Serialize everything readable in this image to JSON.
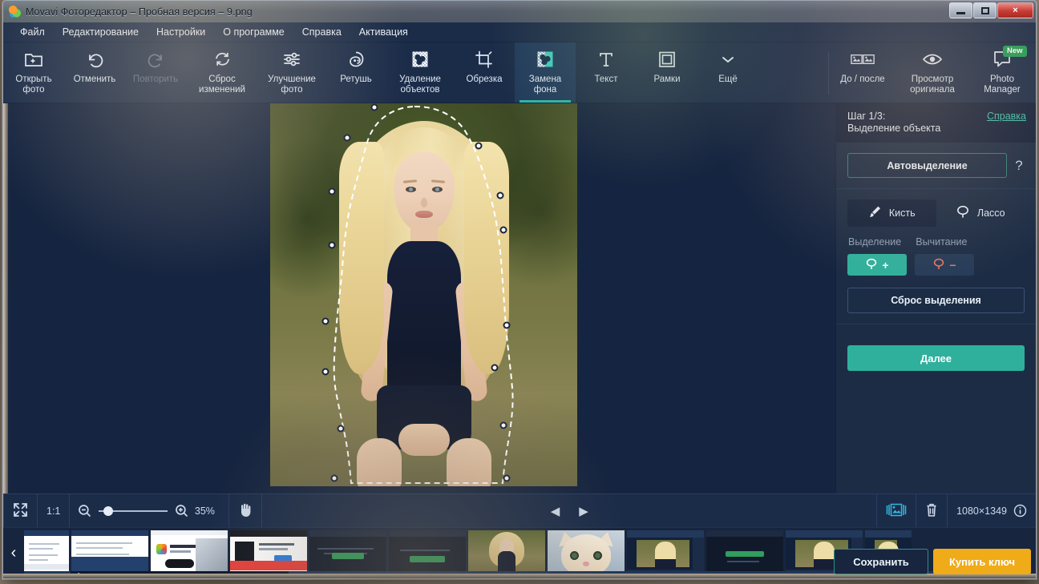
{
  "window": {
    "title": "Movavi Фоторедактор – Пробная версия – 9.png",
    "minimize_label": "Свернуть",
    "maximize_label": "Развернуть",
    "close_label": "×"
  },
  "menubar": {
    "items": [
      {
        "label": "Файл"
      },
      {
        "label": "Редактирование"
      },
      {
        "label": "Настройки"
      },
      {
        "label": "О программе"
      },
      {
        "label": "Справка"
      },
      {
        "label": "Активация"
      }
    ]
  },
  "toolbar": {
    "items": [
      {
        "id": "open-photo",
        "label": "Открыть\nфото",
        "icon": "folder-plus-icon",
        "state": "enabled"
      },
      {
        "id": "undo",
        "label": "Отменить",
        "icon": "undo-icon",
        "state": "enabled"
      },
      {
        "id": "redo",
        "label": "Повторить",
        "icon": "redo-icon",
        "state": "disabled"
      },
      {
        "id": "reset-changes",
        "label": "Сброс\nизменений",
        "icon": "refresh-icon",
        "state": "enabled"
      },
      {
        "id": "enhance-photo",
        "label": "Улучшение\nфото",
        "icon": "sliders-icon",
        "state": "enabled"
      },
      {
        "id": "retouch",
        "label": "Ретушь",
        "icon": "face-icon",
        "state": "enabled"
      },
      {
        "id": "object-removal",
        "label": "Удаление\nобъектов",
        "icon": "eraser-icon",
        "state": "enabled"
      },
      {
        "id": "crop",
        "label": "Обрезка",
        "icon": "crop-icon",
        "state": "enabled"
      },
      {
        "id": "background-change",
        "label": "Замена\nфона",
        "icon": "bg-change-icon",
        "state": "active"
      },
      {
        "id": "text",
        "label": "Текст",
        "icon": "text-t-icon",
        "state": "enabled"
      },
      {
        "id": "frames",
        "label": "Рамки",
        "icon": "frame-icon",
        "state": "enabled"
      },
      {
        "id": "more",
        "label": "Ещё",
        "icon": "chevron-down-icon",
        "state": "enabled"
      }
    ],
    "right_items": [
      {
        "id": "before-after",
        "label": "До / после",
        "icon": "before-after-icon"
      },
      {
        "id": "view-original",
        "label": "Просмотр\nоригинала",
        "icon": "eye-icon"
      },
      {
        "id": "photo-manager",
        "label": "Photo\nManager",
        "icon": "speech-bubble-icon",
        "badge": "New"
      }
    ]
  },
  "right_panel": {
    "step_title": "Шаг 1/3:\nВыделение объекта",
    "help_link": "Справка",
    "auto_select_button": "Автовыделение",
    "auto_select_hint": "?",
    "tools": [
      {
        "id": "brush",
        "label": "Кисть",
        "icon": "brush-icon",
        "selected": true
      },
      {
        "id": "lasso",
        "label": "Лассо",
        "icon": "lasso-icon",
        "selected": false
      }
    ],
    "mode_labels": {
      "select": "Выделение",
      "subtract": "Вычитание"
    },
    "mode_add_icon": "lasso-plus-icon",
    "mode_sub_icon": "lasso-minus-icon",
    "mode_add_glyph": "+",
    "mode_sub_glyph": "−",
    "reset_selection_button": "Сброс выделения",
    "next_button": "Далее"
  },
  "statusbar": {
    "fit_icon": "fit-screen-icon",
    "one_to_one": "1:1",
    "zoom_out_icon": "zoom-out-icon",
    "zoom_in_icon": "zoom-in-icon",
    "zoom_value": "35%",
    "zoom_slider_percent": 8,
    "hand_icon": "hand-icon",
    "prev_icon": "◀",
    "next_icon": "▶",
    "compare_icon": "compare-images-icon",
    "delete_icon": "trash-icon",
    "image_size": "1080×1349",
    "info_icon": "info-icon"
  },
  "filmstrip": {
    "prev_arrow": "‹",
    "next_arrow": "›",
    "thumbnails": [
      {
        "id": "thumb-0",
        "kind": "doc",
        "selected": false,
        "partial": "left"
      },
      {
        "id": "thumb-1",
        "kind": "doc",
        "selected": false
      },
      {
        "id": "thumb-2",
        "kind": "doc2",
        "selected": false
      },
      {
        "id": "thumb-3",
        "kind": "web",
        "selected": false
      },
      {
        "id": "thumb-4",
        "kind": "red",
        "selected": false
      },
      {
        "id": "thumb-5",
        "kind": "dark",
        "selected": false
      },
      {
        "id": "thumb-6",
        "kind": "dark2",
        "selected": false
      },
      {
        "id": "thumb-7",
        "kind": "photo",
        "selected": true
      },
      {
        "id": "thumb-8",
        "kind": "cat",
        "selected": false
      },
      {
        "id": "thumb-9",
        "kind": "app",
        "selected": false
      },
      {
        "id": "thumb-10",
        "kind": "dark3",
        "selected": false
      },
      {
        "id": "thumb-11",
        "kind": "app2",
        "selected": false,
        "partial": "right"
      }
    ]
  },
  "actions": {
    "save_button": "Сохранить",
    "buy_key_button": "Купить ключ"
  },
  "colors": {
    "accent_teal": "#2fb09c",
    "panel_bg": "#1c2c45",
    "toolbar_bg": "#1b2c49",
    "canvas_bg": "#152440",
    "buy_orange": "#f0ab19",
    "badge_green": "#1f9d55",
    "selection_blue": "#2fb9c9"
  }
}
